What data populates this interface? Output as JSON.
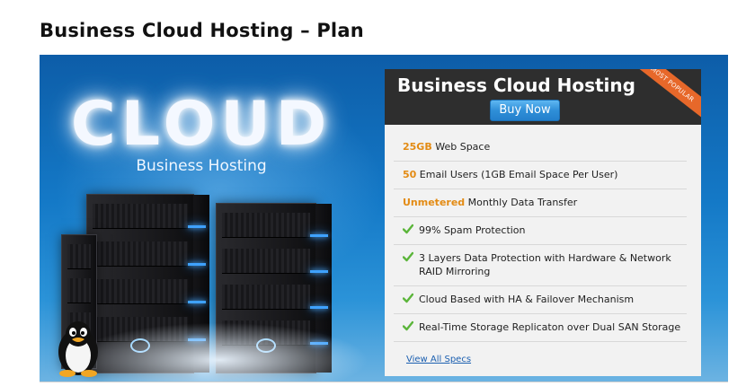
{
  "page": {
    "title": "Business Cloud Hosting – Plan"
  },
  "banner": {
    "headline": "CLOUD",
    "subtitle": "Business Hosting"
  },
  "plan": {
    "name": "Business Cloud Hosting",
    "buy_label": "Buy Now",
    "ribbon": "MOST POPULAR",
    "features": [
      {
        "highlight": "25GB",
        "text": " Web Space"
      },
      {
        "highlight": "50",
        "text": " Email Users (1GB Email Space Per User)"
      },
      {
        "highlight": "Unmetered",
        "text": " Monthly Data Transfer"
      },
      {
        "text": "99% Spam Protection"
      },
      {
        "text": "3 Layers Data Protection with Hardware & Network RAID Mirroring"
      },
      {
        "text": "Cloud Based with HA & Failover Mechanism"
      },
      {
        "text": "Real-Time Storage Replicaton over Dual SAN Storage"
      }
    ],
    "view_specs_label": "View All Specs"
  },
  "colors": {
    "highlight": "#e38b14",
    "check": "#5bb53a",
    "button": "#2f8fd8",
    "ribbon": "#e7682a",
    "header_bg": "#2e2e2e"
  },
  "icons": {
    "feature_check": "checkmark-icon",
    "mascot": "penguin-icon"
  }
}
